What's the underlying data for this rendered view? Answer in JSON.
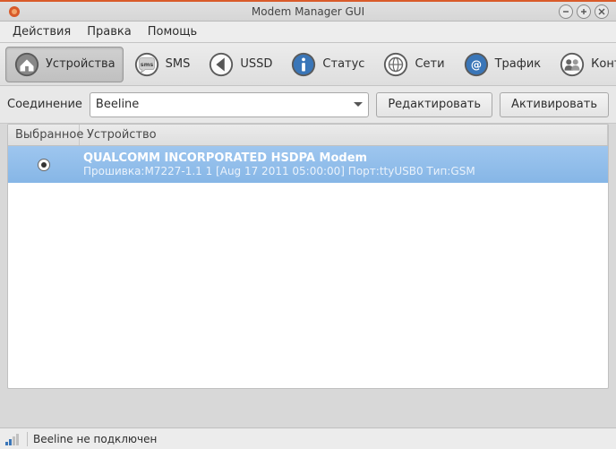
{
  "window": {
    "title": "Modem Manager GUI"
  },
  "menu": {
    "actions": "Действия",
    "edit": "Правка",
    "help": "Помощь"
  },
  "toolbar": {
    "devices": "Устройства",
    "sms": "SMS",
    "ussd": "USSD",
    "status": "Статус",
    "nets": "Сети",
    "traffic": "Трафик",
    "contacts": "Контакты"
  },
  "conn": {
    "label": "Соединение",
    "value": "Beeline",
    "edit": "Редактировать",
    "activate": "Активировать"
  },
  "headers": {
    "selected": "Выбранное",
    "device": "Устройство"
  },
  "devices": [
    {
      "name": "QUALCOMM INCORPORATED HSDPA Modem",
      "info": "Прошивка:M7227-1.1  1  [Aug 17 2011 05:00:00] Порт:ttyUSB0 Тип:GSM",
      "selected": true
    }
  ],
  "status": {
    "text": "Beeline не подключен"
  }
}
